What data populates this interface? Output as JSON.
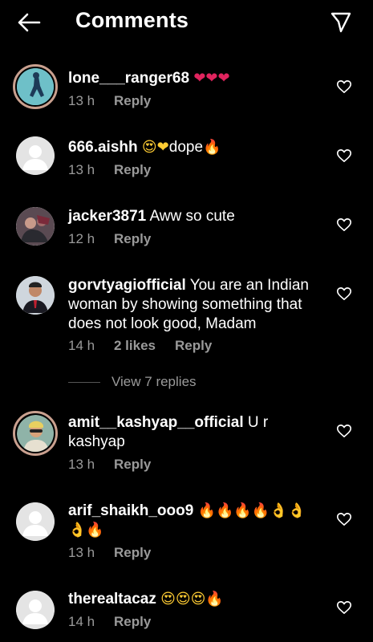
{
  "header": {
    "title": "Comments"
  },
  "comments": [
    {
      "username": "lone___ranger68",
      "text": "",
      "emoji": "❤❤❤",
      "time": "13 h",
      "likes": "",
      "reply": "Reply"
    },
    {
      "username": "666.aishh",
      "text": "dope",
      "emoji_before": "😍❤",
      "emoji": "🔥",
      "time": "13 h",
      "likes": "",
      "reply": "Reply"
    },
    {
      "username": "jacker3871",
      "text": "Aww so cute",
      "emoji": "",
      "time": "12 h",
      "likes": "",
      "reply": "Reply"
    },
    {
      "username": "gorvtyagiofficial",
      "text": "You are an Indian woman by showing something that does not look good, Madam",
      "emoji": "",
      "time": "14 h",
      "likes": "2 likes",
      "reply": "Reply"
    },
    {
      "username": "amit__kashyap__official",
      "text": "U r kashyap",
      "emoji": "",
      "time": "13 h",
      "likes": "",
      "reply": "Reply"
    },
    {
      "username": "arif_shaikh_ooo9",
      "text": "",
      "emoji": "🔥🔥🔥🔥👌👌👌🔥",
      "time": "13 h",
      "likes": "",
      "reply": "Reply"
    },
    {
      "username": "therealtacaz",
      "text": "",
      "emoji": "😍😍😍🔥",
      "time": "14 h",
      "likes": "",
      "reply": "Reply"
    }
  ],
  "view_replies": "View 7 replies",
  "colors": {
    "background": "#000000",
    "text": "#ffffff",
    "secondary": "#9a9a9a",
    "heart_red": "#e0245e",
    "fire": "#ff6a1a"
  }
}
